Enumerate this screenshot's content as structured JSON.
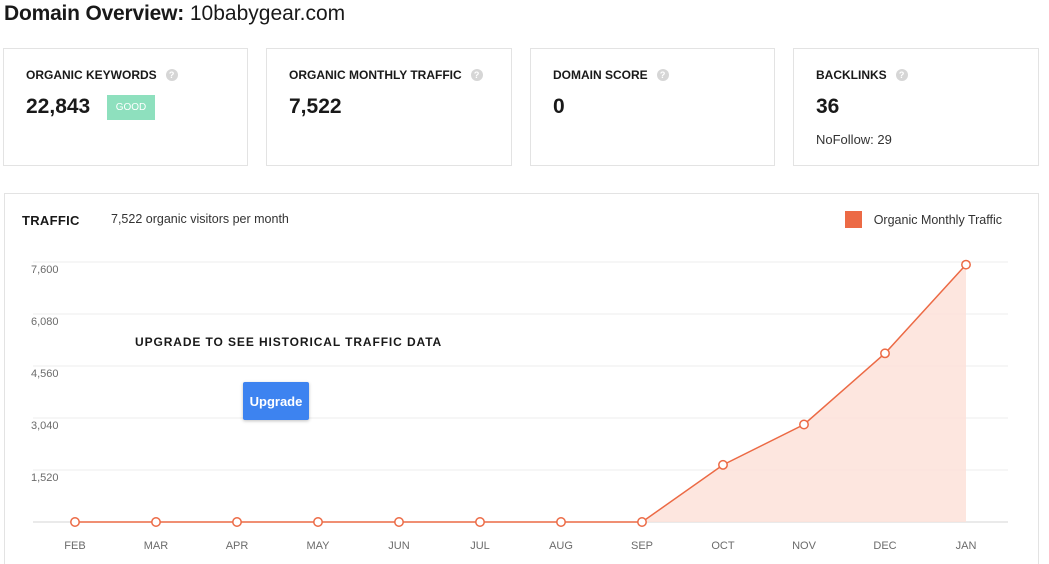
{
  "header": {
    "lead": "Domain Overview:",
    "domain": "10babygear.com"
  },
  "cards": [
    {
      "title": "ORGANIC KEYWORDS",
      "value": "22,843",
      "badge": "GOOD"
    },
    {
      "title": "ORGANIC MONTHLY TRAFFIC",
      "value": "7,522"
    },
    {
      "title": "DOMAIN SCORE",
      "value": "0"
    },
    {
      "title": "BACKLINKS",
      "value": "36",
      "sub": "NoFollow: 29"
    }
  ],
  "traffic": {
    "title": "TRAFFIC",
    "subtitle": "7,522 organic visitors per month",
    "legend": "Organic Monthly Traffic",
    "upgrade_message": "UPGRADE TO SEE HISTORICAL TRAFFIC DATA",
    "upgrade_button": "Upgrade"
  },
  "colors": {
    "accent": "#ec6a45",
    "fill": "#fde2d9",
    "badge": "#8ee0be",
    "button": "#3d83f0"
  },
  "icons": {
    "help": "question-circle-icon"
  },
  "chart_data": {
    "type": "area",
    "categories": [
      "FEB",
      "MAR",
      "APR",
      "MAY",
      "JUN",
      "JUL",
      "AUG",
      "SEP",
      "OCT",
      "NOV",
      "DEC",
      "JAN"
    ],
    "series": [
      {
        "name": "Organic Monthly Traffic",
        "values": [
          0,
          0,
          0,
          0,
          0,
          0,
          0,
          0,
          1670,
          2850,
          4930,
          7522
        ]
      }
    ],
    "yticks": [
      "7,600",
      "6,080",
      "4,560",
      "3,040",
      "1,520"
    ],
    "ylim": [
      0,
      7600
    ],
    "grid": true,
    "legend_position": "top-right"
  }
}
